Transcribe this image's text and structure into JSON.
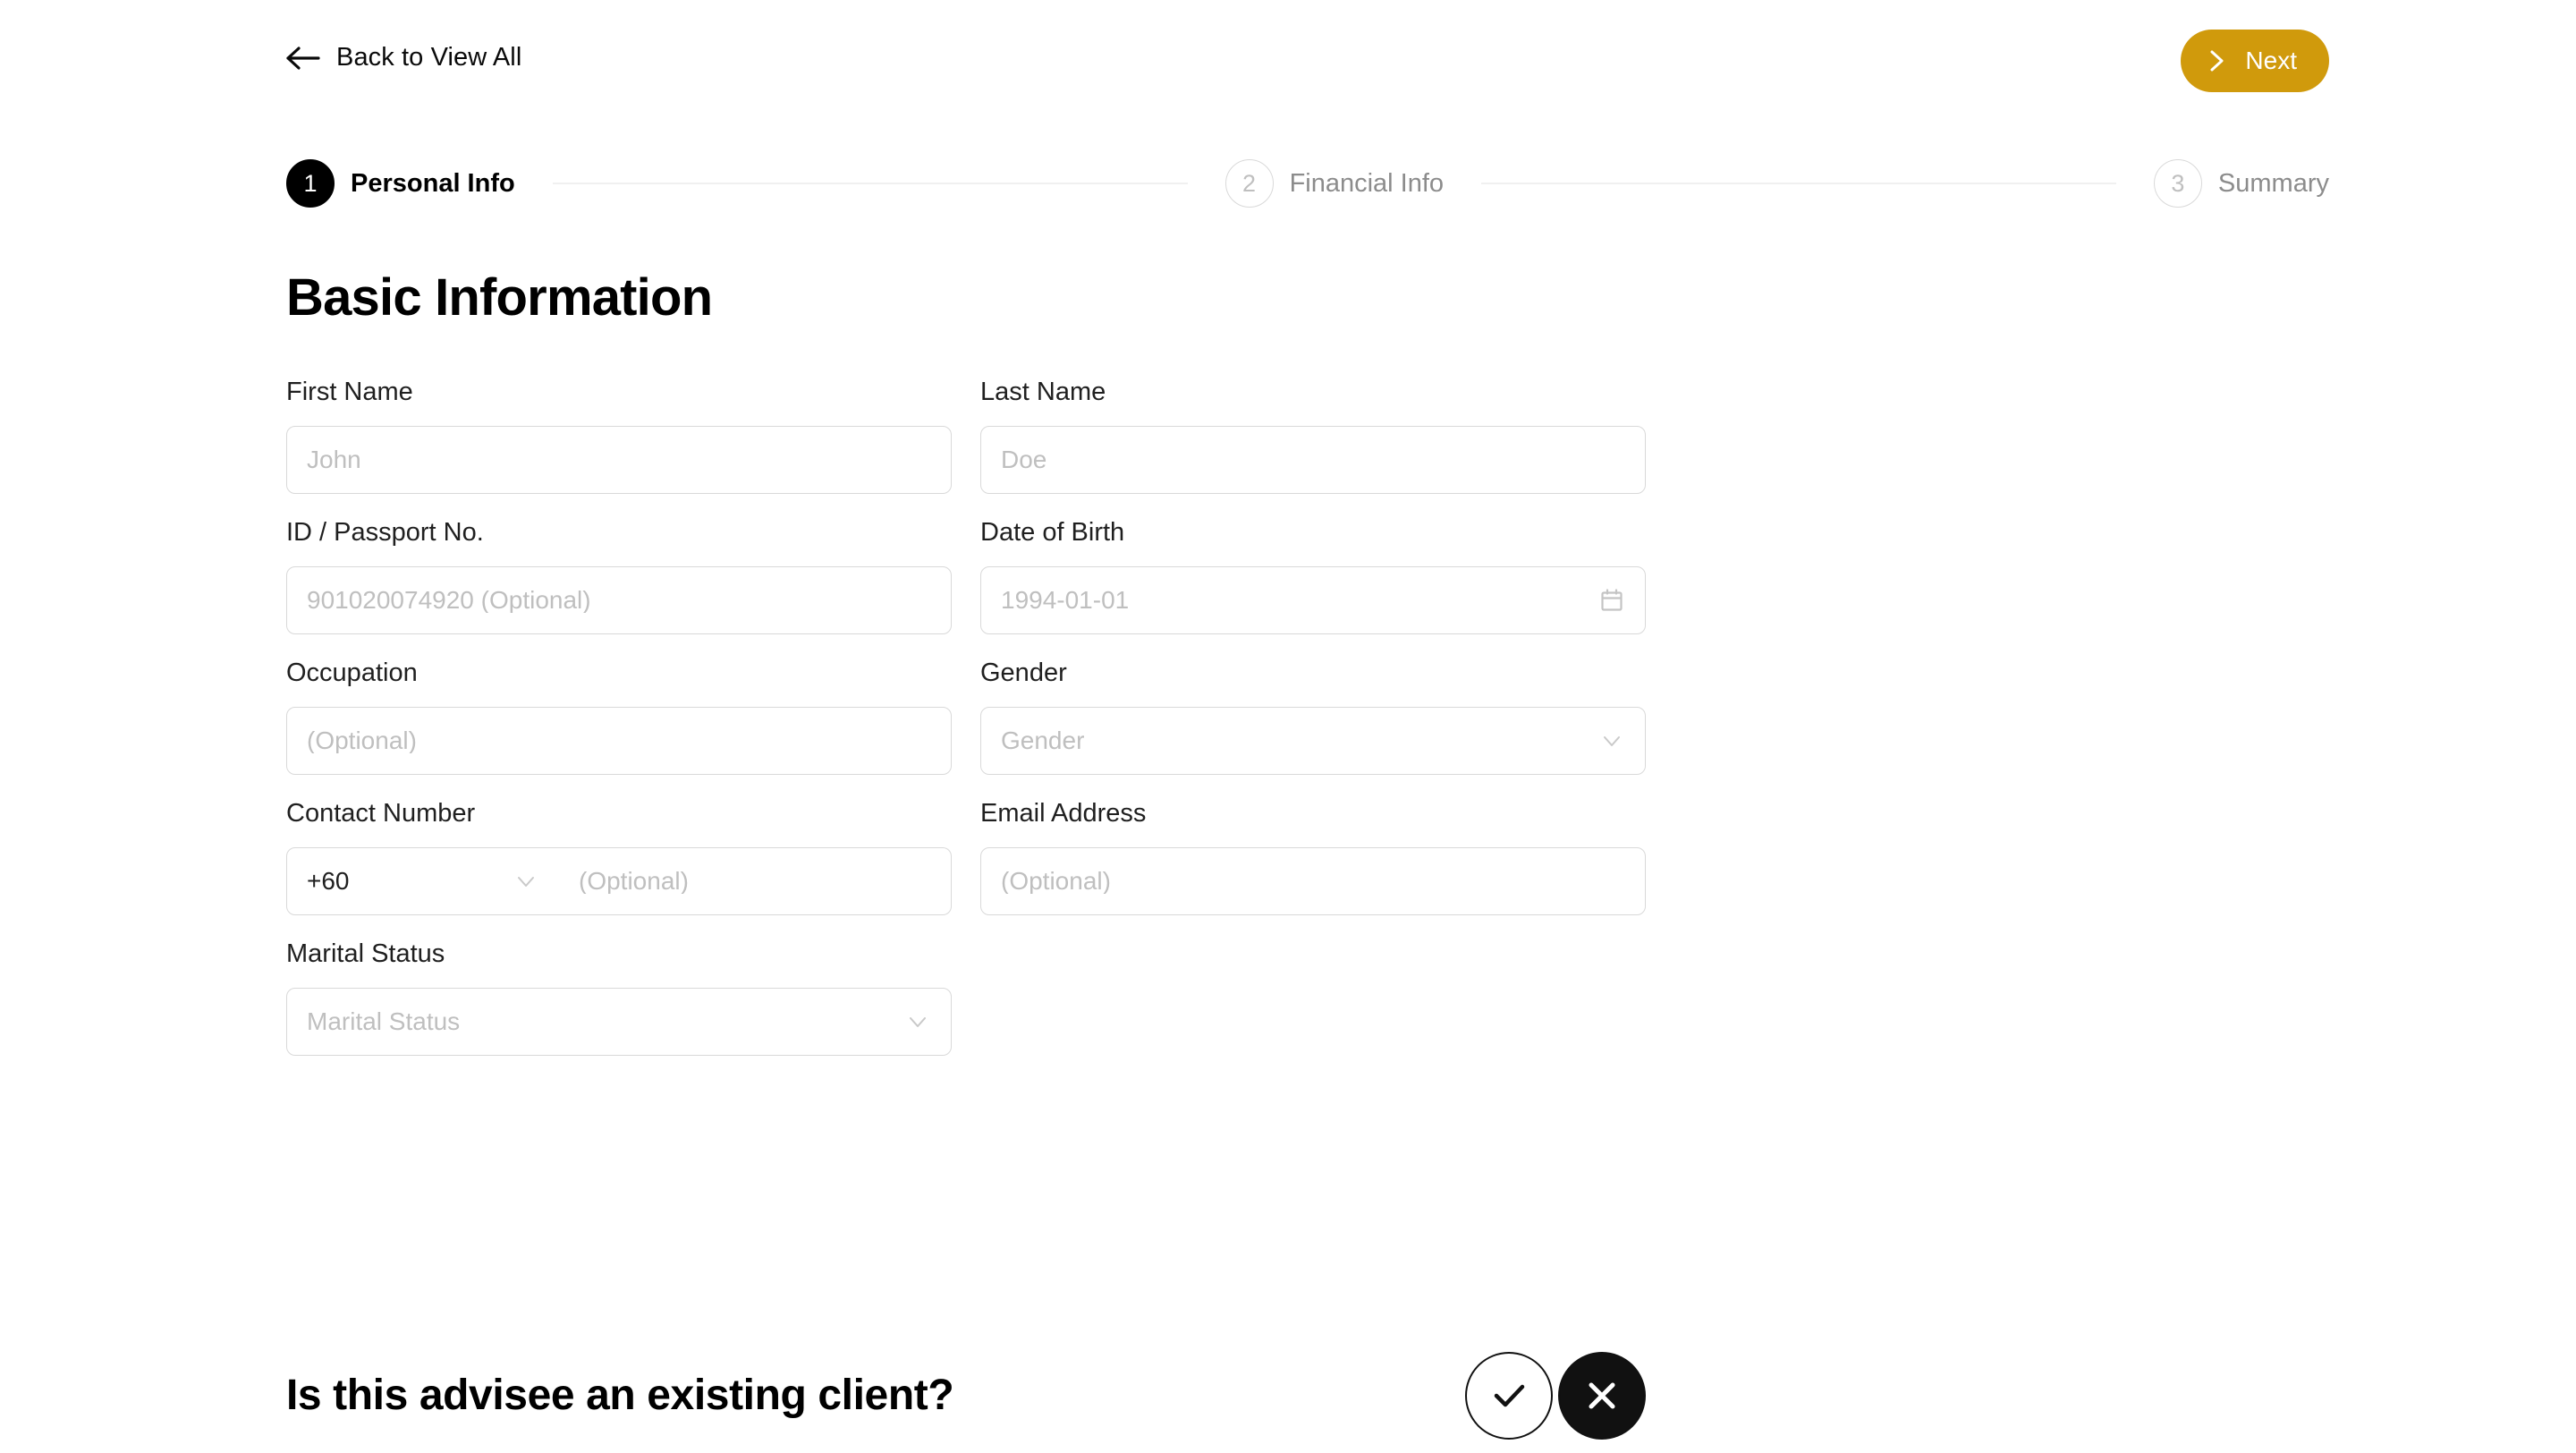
{
  "topbar": {
    "back_label": "Back to View All",
    "back_icon": "arrow-left-icon",
    "next_label": "Next",
    "next_icon": "chevron-right-icon",
    "next_color": "#d09a0c"
  },
  "stepper": {
    "steps": [
      {
        "number": "1",
        "label": "Personal Info",
        "state": "active"
      },
      {
        "number": "2",
        "label": "Financial Info",
        "state": "inactive"
      },
      {
        "number": "3",
        "label": "Summary",
        "state": "inactive"
      }
    ]
  },
  "main": {
    "section_title": "Basic Information",
    "fields": {
      "first_name": {
        "label": "First Name",
        "value": "",
        "placeholder": "John"
      },
      "last_name": {
        "label": "Last Name",
        "value": "",
        "placeholder": "Doe"
      },
      "id_passport": {
        "label": "ID / Passport No.",
        "value": "",
        "placeholder": "901020074920 (Optional)"
      },
      "date_of_birth": {
        "label": "Date of Birth",
        "value": "",
        "placeholder": "1994-01-01",
        "icon": "calendar-icon"
      },
      "occupation": {
        "label": "Occupation",
        "value": "",
        "placeholder": "(Optional)"
      },
      "gender": {
        "label": "Gender",
        "value": "",
        "placeholder": "Gender",
        "icon": "chevron-down-icon"
      },
      "contact_number": {
        "label": "Contact Number",
        "country_code": "+60",
        "code_icon": "chevron-down-icon",
        "value": "",
        "placeholder": "(Optional)"
      },
      "email_address": {
        "label": "Email Address",
        "value": "",
        "placeholder": "(Optional)"
      },
      "marital_status": {
        "label": "Marital Status",
        "value": "",
        "placeholder": "Marital Status",
        "icon": "chevron-down-icon"
      }
    }
  },
  "existing_client": {
    "question": "Is this advisee an existing client?",
    "yes_icon": "check-icon",
    "no_icon": "x-icon",
    "selected": "no"
  }
}
